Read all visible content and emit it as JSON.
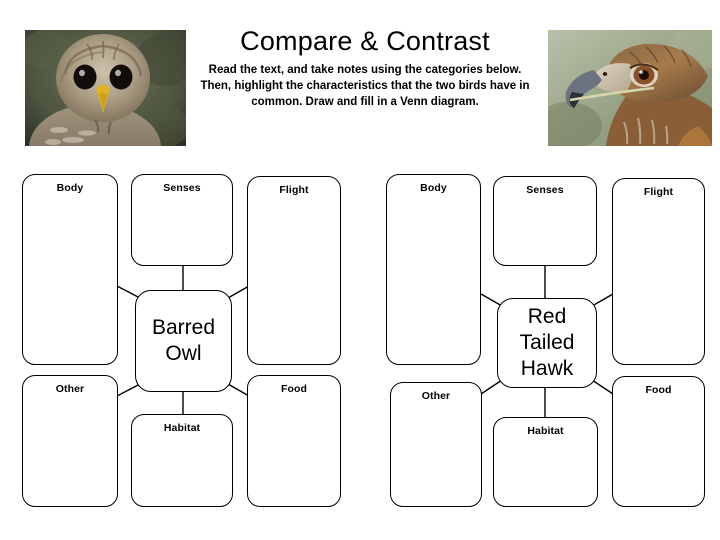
{
  "header": {
    "title": "Compare & Contrast",
    "instructions": "Read the text, and take notes using the categories below. Then, highlight the characteristics that the two birds have in common. Draw and fill in a Venn diagram."
  },
  "images": {
    "left": {
      "name": "barred-owl-photo",
      "alt": "Barred Owl head facing forward"
    },
    "right": {
      "name": "red-tailed-hawk-photo",
      "alt": "Red Tailed Hawk head in profile"
    }
  },
  "diagrams": [
    {
      "id": "barred-owl",
      "center": "Barred Owl",
      "nodes": [
        {
          "key": "body",
          "label": "Body",
          "value": ""
        },
        {
          "key": "senses",
          "label": "Senses",
          "value": ""
        },
        {
          "key": "flight",
          "label": "Flight",
          "value": ""
        },
        {
          "key": "other",
          "label": "Other",
          "value": ""
        },
        {
          "key": "habitat",
          "label": "Habitat",
          "value": ""
        },
        {
          "key": "food",
          "label": "Food",
          "value": ""
        }
      ]
    },
    {
      "id": "red-tailed-hawk",
      "center": "Red Tailed Hawk",
      "nodes": [
        {
          "key": "body",
          "label": "Body",
          "value": ""
        },
        {
          "key": "senses",
          "label": "Senses",
          "value": ""
        },
        {
          "key": "flight",
          "label": "Flight",
          "value": ""
        },
        {
          "key": "other",
          "label": "Other",
          "value": ""
        },
        {
          "key": "habitat",
          "label": "Habitat",
          "value": ""
        },
        {
          "key": "food",
          "label": "Food",
          "value": ""
        }
      ]
    }
  ],
  "colors": {
    "page_background": "#ffffff",
    "ink": "#000000",
    "box_border": "#000000"
  }
}
